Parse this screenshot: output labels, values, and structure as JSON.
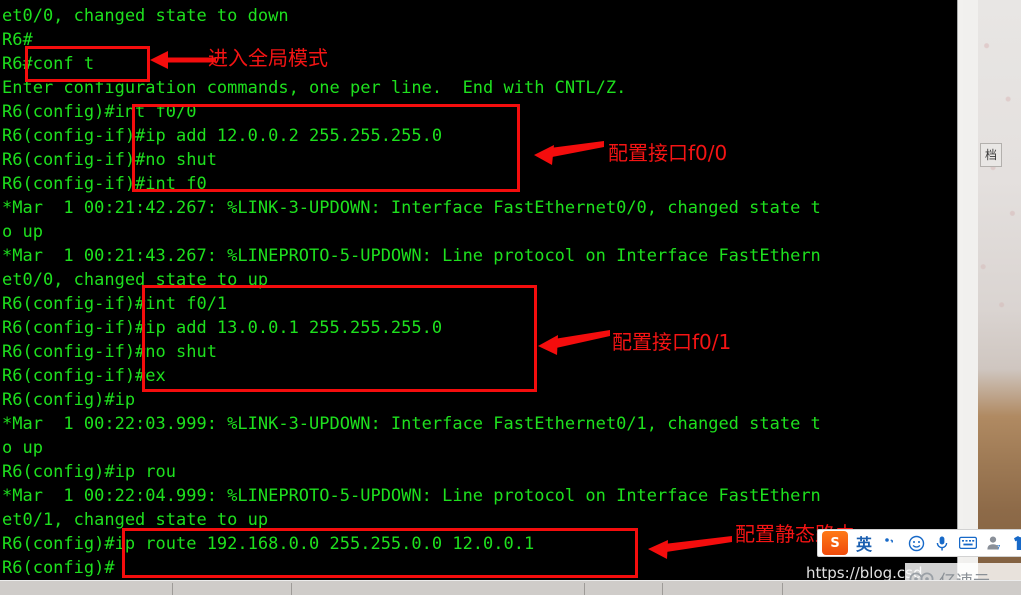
{
  "terminal": {
    "lines": [
      "et0/0, changed state to down",
      "R6#",
      "R6#conf t",
      "Enter configuration commands, one per line.  End with CNTL/Z.",
      "R6(config)#int f0/0",
      "R6(config-if)#ip add 12.0.0.2 255.255.255.0",
      "R6(config-if)#no shut",
      "R6(config-if)#int f0",
      "*Mar  1 00:21:42.267: %LINK-3-UPDOWN: Interface FastEthernet0/0, changed state t",
      "o up",
      "*Mar  1 00:21:43.267: %LINEPROTO-5-UPDOWN: Line protocol on Interface FastEthern",
      "et0/0, changed state to up",
      "R6(config-if)#int f0/1",
      "R6(config-if)#ip add 13.0.0.1 255.255.255.0",
      "R6(config-if)#no shut",
      "R6(config-if)#ex",
      "R6(config)#ip",
      "*Mar  1 00:22:03.999: %LINK-3-UPDOWN: Interface FastEthernet0/1, changed state t",
      "o up",
      "R6(config)#ip rou",
      "*Mar  1 00:22:04.999: %LINEPROTO-5-UPDOWN: Line protocol on Interface FastEthern",
      "et0/1, changed state to up",
      "R6(config)#ip route 192.168.0.0 255.255.0.0 12.0.0.1",
      "R6(config)#"
    ],
    "text_color": "#1ee01e",
    "background_color": "#000000"
  },
  "annotations": {
    "color": "#f40d0d",
    "items": [
      {
        "label": "进入全局模式",
        "highlights": "R6#conf t"
      },
      {
        "label": "配置接口f0/0",
        "highlights": "int f0/0 ... ip add 12.0.0.2 255.255.255.0"
      },
      {
        "label": "配置接口f0/1",
        "highlights": "int f0/1 ... ip add 13.0.0.1 255.255.255.0"
      },
      {
        "label": "配置静态路由",
        "highlights": "ip route 192.168.0.0 255.255.0.0 12.0.0.1"
      }
    ]
  },
  "ime_toolbar": {
    "logo_label": "S",
    "language_mode": "英",
    "items": [
      "sogou-logo-icon",
      "language-toggle",
      "punctuation-icon",
      "emoji-icon",
      "microphone-icon",
      "soft-keyboard-icon",
      "user-account-icon",
      "skin-icon",
      "toolbox-icon"
    ]
  },
  "watermarks": {
    "blog_url": "https://blog.csd",
    "site_name": "亿速云"
  },
  "window": {
    "frame_tab_label": "档"
  }
}
